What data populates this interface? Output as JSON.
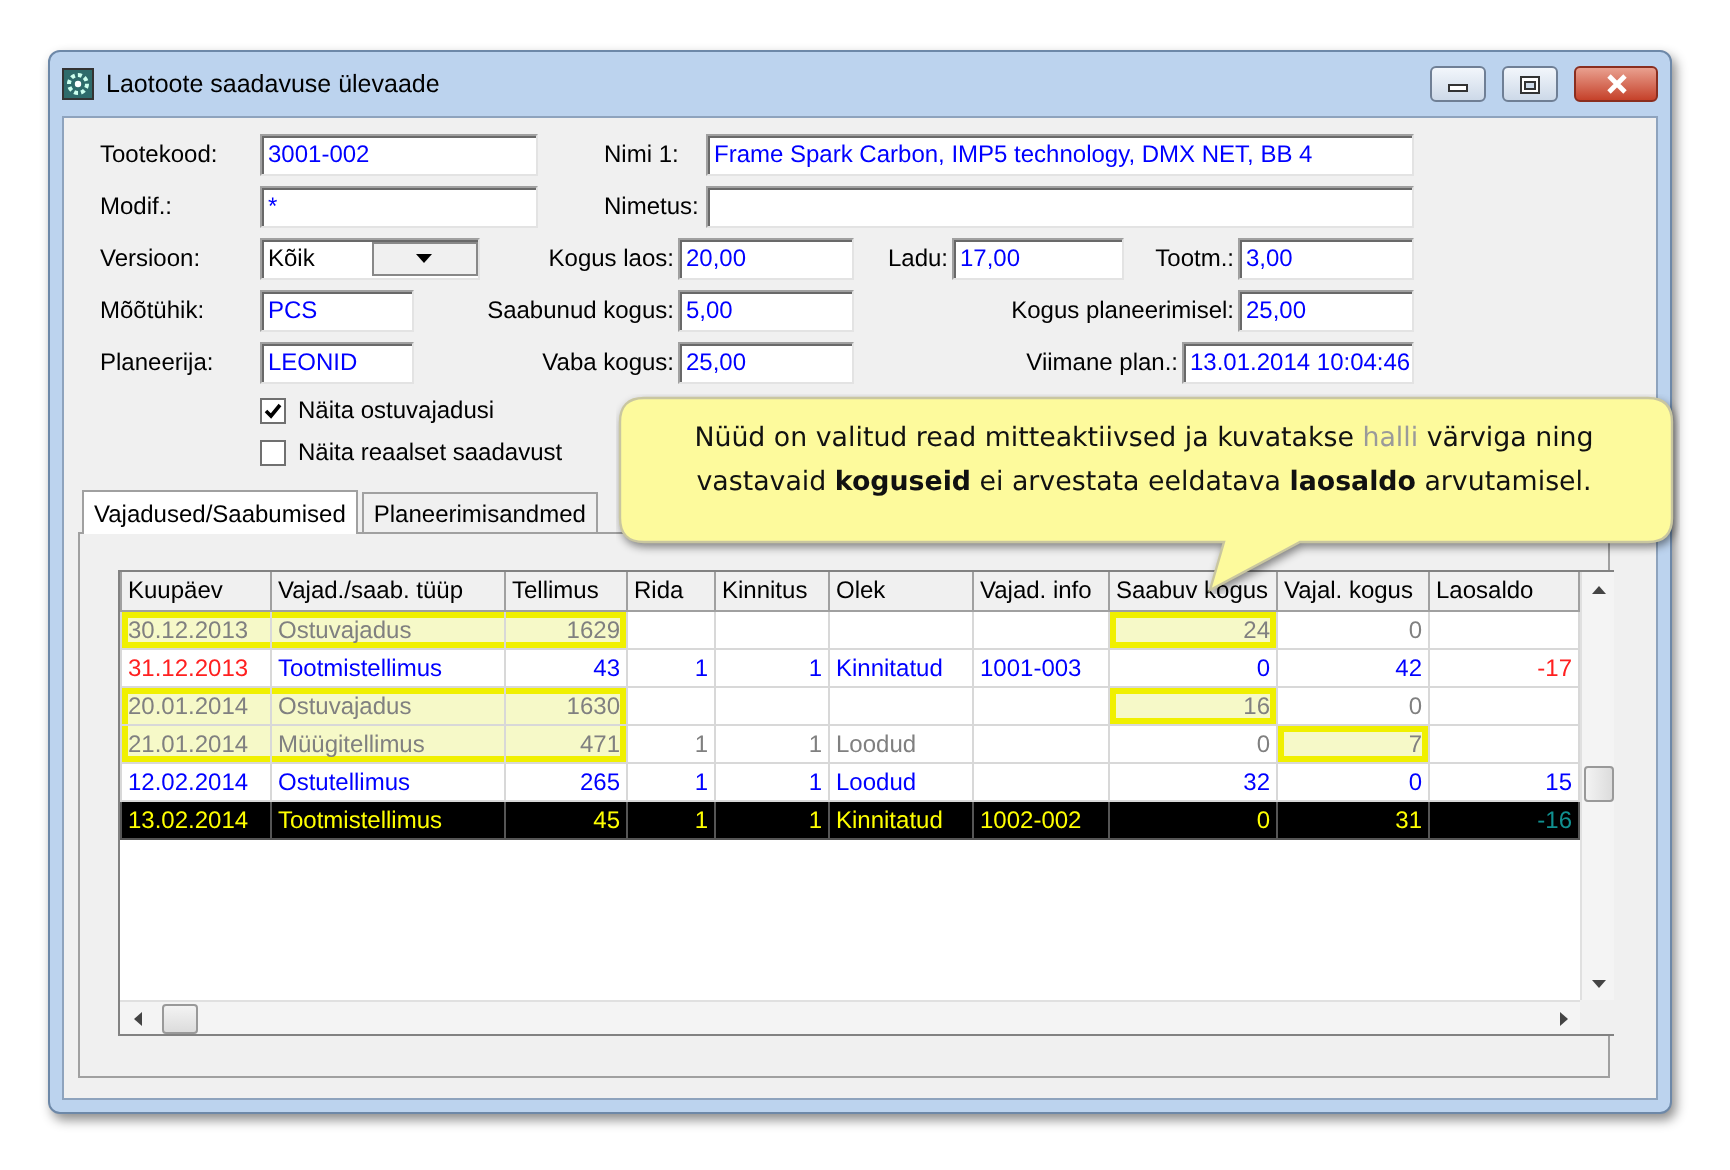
{
  "window": {
    "title": "Laotoote saadavuse ülevaade"
  },
  "form": {
    "fields": [
      {
        "label": "Tootekood:",
        "value": "3001-002",
        "kind": "text"
      },
      {
        "label": "Nimi 1:",
        "value": "Frame Spark Carbon, IMP5 technology, DMX NET, BB 4",
        "kind": "text"
      },
      {
        "label": "Modif.:",
        "value": "*",
        "kind": "text"
      },
      {
        "label": "Nimetus:",
        "kind": "text"
      },
      {
        "label": "Versioon:",
        "value": "Kõik",
        "kind": "select"
      },
      {
        "label": "Kogus laos:",
        "value": "20,00",
        "kind": "text"
      },
      {
        "label": "Ladu:",
        "value": "17,00",
        "kind": "text"
      },
      {
        "label": "Tootm.:",
        "value": "3,00",
        "kind": "text"
      },
      {
        "label": "Mõõtühik:",
        "value": "PCS",
        "kind": "text"
      },
      {
        "label": "Saabunud kogus:",
        "value": "5,00",
        "kind": "text"
      },
      {
        "label": "Kogus planeerimisel:",
        "value": "25,00",
        "kind": "text"
      },
      {
        "label": "Planeerija:",
        "value": "LEONID",
        "kind": "text"
      },
      {
        "label": "Vaba kogus:",
        "value": "25,00",
        "kind": "text"
      },
      {
        "label": "Viimane plan.:",
        "value": "13.01.2014 10:04:46",
        "kind": "text"
      }
    ]
  },
  "checkboxes": [
    {
      "label": "Näita ostuvajadusi",
      "checked": true
    },
    {
      "label": "Näita reaalset saadavust",
      "checked": false
    }
  ],
  "callout": {
    "parts": [
      {
        "text": "Nüüd on valitud read mitteaktiivsed ja kuvatakse ",
        "kind": "plain"
      },
      {
        "text": "halli",
        "kind": "grey"
      },
      {
        "text": " värviga ning vastavaid ",
        "kind": "plain"
      },
      {
        "text": "koguseid",
        "kind": "bold"
      },
      {
        "text": " ei arvestata eeldatava ",
        "kind": "plain"
      },
      {
        "text": "laosaldo",
        "kind": "bold"
      },
      {
        "text": " arvutamisel.",
        "kind": "plain"
      }
    ]
  },
  "tabs": [
    {
      "label": "Vajadused/Saabumised",
      "selected": true
    },
    {
      "label": "Planeerimisandmed",
      "selected": false
    }
  ],
  "table": {
    "columns": [
      "Kuupäev",
      "Vajad./saab. tüüp",
      "Tellimus",
      "Rida",
      "Kinnitus",
      "Olek",
      "Vajad. info",
      "Saabuv kogus",
      "Vajal. kogus",
      "Laosaldo"
    ],
    "rows": [
      {
        "kind": "inactive",
        "overdue": false,
        "shortage": false,
        "selected": false,
        "cells": [
          {
            "text": "30.12.2013",
            "highlighted": true
          },
          {
            "text": "Ostuvajadus",
            "highlighted": true
          },
          {
            "text": "1629",
            "highlighted": true
          },
          {
            "highlighted": false
          },
          {
            "highlighted": false
          },
          {
            "highlighted": false
          },
          {
            "highlighted": false
          },
          {
            "text": "24",
            "highlighted": true
          },
          {
            "text": "0",
            "highlighted": false
          },
          {
            "highlighted": false
          }
        ]
      },
      {
        "kind": "active",
        "overdue": true,
        "shortage": true,
        "selected": false,
        "cells": [
          {
            "text": "31.12.2013",
            "highlighted": false
          },
          {
            "text": "Tootmistellimus",
            "highlighted": false
          },
          {
            "text": "43",
            "highlighted": false
          },
          {
            "text": "1",
            "highlighted": false
          },
          {
            "text": "1",
            "highlighted": false
          },
          {
            "text": "Kinnitatud",
            "highlighted": false
          },
          {
            "text": "1001-003",
            "highlighted": false
          },
          {
            "text": "0",
            "highlighted": false
          },
          {
            "text": "42",
            "highlighted": false
          },
          {
            "text": "-17",
            "highlighted": false
          }
        ]
      },
      {
        "kind": "inactive",
        "overdue": false,
        "shortage": false,
        "selected": false,
        "cells": [
          {
            "text": "20.01.2014",
            "highlighted": true
          },
          {
            "text": "Ostuvajadus",
            "highlighted": true
          },
          {
            "text": "1630",
            "highlighted": true
          },
          {
            "highlighted": false
          },
          {
            "highlighted": false
          },
          {
            "highlighted": false
          },
          {
            "highlighted": false
          },
          {
            "text": "16",
            "highlighted": true
          },
          {
            "text": "0",
            "highlighted": false
          },
          {
            "highlighted": false
          }
        ]
      },
      {
        "kind": "inactive",
        "overdue": false,
        "shortage": false,
        "selected": false,
        "cells": [
          {
            "text": "21.01.2014",
            "highlighted": true
          },
          {
            "text": "Müügitellimus",
            "highlighted": true
          },
          {
            "text": "471",
            "highlighted": true
          },
          {
            "text": "1",
            "highlighted": false
          },
          {
            "text": "1",
            "highlighted": false
          },
          {
            "text": "Loodud",
            "highlighted": false
          },
          {
            "highlighted": false
          },
          {
            "text": "0",
            "highlighted": false
          },
          {
            "text": "7",
            "highlighted": true
          },
          {
            "highlighted": false
          }
        ]
      },
      {
        "kind": "active",
        "overdue": false,
        "shortage": false,
        "selected": false,
        "cells": [
          {
            "text": "12.02.2014",
            "highlighted": false
          },
          {
            "text": "Ostutellimus",
            "highlighted": false
          },
          {
            "text": "265",
            "highlighted": false
          },
          {
            "text": "1",
            "highlighted": false
          },
          {
            "text": "1",
            "highlighted": false
          },
          {
            "text": "Loodud",
            "highlighted": false
          },
          {
            "highlighted": false
          },
          {
            "text": "32",
            "highlighted": false
          },
          {
            "text": "0",
            "highlighted": false
          },
          {
            "text": "15",
            "highlighted": false
          }
        ]
      },
      {
        "kind": "active",
        "overdue": false,
        "shortage": true,
        "selected": true,
        "cells": [
          {
            "text": "13.02.2014",
            "highlighted": false
          },
          {
            "text": "Tootmistellimus",
            "highlighted": false
          },
          {
            "text": "45",
            "highlighted": false
          },
          {
            "text": "1",
            "highlighted": false
          },
          {
            "text": "1",
            "highlighted": false
          },
          {
            "text": "Kinnitatud",
            "highlighted": false
          },
          {
            "text": "1002-002",
            "highlighted": false
          },
          {
            "text": "0",
            "highlighted": false
          },
          {
            "text": "31",
            "highlighted": false
          },
          {
            "text": "-16",
            "highlighted": false
          }
        ]
      }
    ]
  }
}
